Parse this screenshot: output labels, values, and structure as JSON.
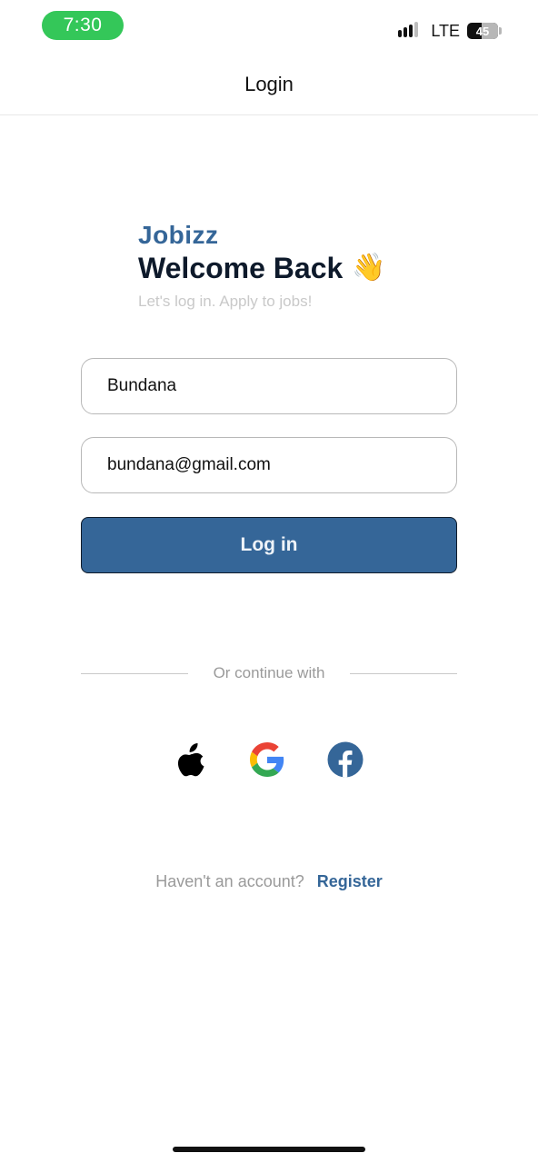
{
  "status_bar": {
    "time": "7:30",
    "network": "LTE",
    "battery": "45",
    "time_pill_color": "#34c759"
  },
  "header": {
    "title": "Login"
  },
  "hero": {
    "brand": "Jobizz",
    "welcome": "Welcome Back",
    "wave_emoji": "👋",
    "tagline": "Let's log in. Apply to jobs!"
  },
  "form": {
    "name_value": "Bundana",
    "email_value": "bundana@gmail.com",
    "login_label": "Log in"
  },
  "divider": {
    "text": "Or continue with"
  },
  "social": {
    "items": [
      {
        "name": "apple-icon"
      },
      {
        "name": "google-icon"
      },
      {
        "name": "facebook-icon"
      }
    ]
  },
  "footer": {
    "question": "Haven't an account?",
    "register_label": "Register"
  },
  "colors": {
    "brand": "#356698",
    "heading": "#0e1a2b",
    "muted": "#9a9a9a"
  }
}
